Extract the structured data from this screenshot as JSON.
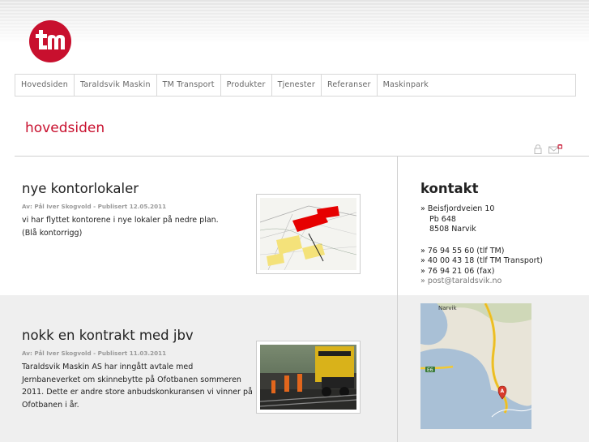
{
  "brand": {
    "logo_text": "tm",
    "accent_color": "#c8102e"
  },
  "nav": {
    "items": [
      {
        "label": "Hovedsiden"
      },
      {
        "label": "Taraldsvik Maskin"
      },
      {
        "label": "TM Transport"
      },
      {
        "label": "Produkter"
      },
      {
        "label": "Tjenester"
      },
      {
        "label": "Referanser"
      },
      {
        "label": "Maskinpark"
      }
    ]
  },
  "page": {
    "title": "hovedsiden"
  },
  "articles": [
    {
      "title": "nye kontorlokaler",
      "meta": "Av: Pål Iver Skogvold - Publisert 12.05.2011",
      "body": [
        "vi har flyttet kontorene i nye lokaler på nedre plan.",
        "(Blå kontorrigg)"
      ]
    },
    {
      "title": "nokk en kontrakt med jbv",
      "meta": "Av: Pål Iver Skogvold - Publisert 11.03.2011",
      "body": [
        "Taraldsvik Maskin AS har inngått avtale med Jernbaneverket om skinnebytte på Ofotbanen sommeren 2011. Dette er andre store anbudskonkuransen vi vinner på Ofotbanen i år."
      ]
    }
  ],
  "contact": {
    "title": "kontakt",
    "address": [
      "» Beisfjordveien 10",
      "Pb 648",
      "8508 Narvik"
    ],
    "phones": [
      "» 76 94 55 60 (tlf TM)",
      "» 40 00 43 18 (tlf TM Transport)",
      "» 76 94 21 06 (fax)"
    ],
    "email": "» post@taraldsvik.no"
  },
  "map": {
    "place_label": "Narvik",
    "road_label": "E6",
    "marker_label": "A"
  }
}
